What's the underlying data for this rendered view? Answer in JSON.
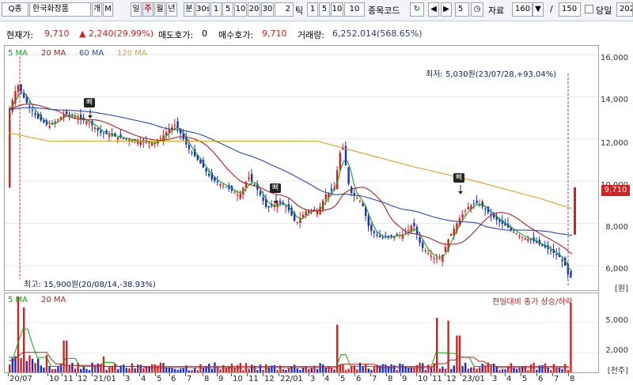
{
  "toolbar": {
    "search_label": "Q종",
    "stock_name": "한국화장품",
    "btn_ge": "개",
    "btn_m": "M",
    "periods": [
      "일",
      "주",
      "월",
      "년",
      "분"
    ],
    "active_period": "일",
    "min_select": "30s",
    "min_buttons": [
      "1",
      "5",
      "10",
      "20",
      "30"
    ],
    "tick_value": "2",
    "tick_label": "틱",
    "tick_buttons": [
      "1",
      "5",
      "10",
      "10"
    ],
    "code_label": "종목코드",
    "count_value": "5",
    "data_label": "자료",
    "data_value": "160",
    "slash": "/",
    "total_value": "150",
    "day_label": "당일",
    "date_value": "202"
  },
  "info": {
    "price_label": "현재가:",
    "price_value": "9,710",
    "change_value": "2,240(29.99%)",
    "ask_label": "매도호가:",
    "ask_value": "0",
    "bid_label": "매수호가:",
    "bid_value": "9,710",
    "volume_label": "거래량:",
    "volume_value": "6,252,014(568.65%)"
  },
  "legend_price": [
    "5 MA",
    "20 MA",
    "60 MA",
    "120 MA"
  ],
  "legend_volume": [
    "5 MA",
    "20 MA"
  ],
  "colors": {
    "ma5": "#12a312",
    "ma20": "#b42020",
    "ma60": "#2a47b8",
    "ma120": "#e0a020",
    "up": "#d62020",
    "down": "#1a2ec8"
  },
  "price_axis": [
    "16,000",
    "14,000",
    "12,000",
    "10,000",
    "8,000",
    "6,000"
  ],
  "price_unit": "[원]",
  "volume_axis": [
    "5,000",
    "2,000"
  ],
  "volume_unit": "[천주]",
  "current_price_tag": "9,710",
  "annotations": {
    "low": "최저: 5,030원(23/07/28,+93.04%)",
    "high": "최고: 15,900원(20/08/14,-38.93%)",
    "volume_note": "전일대비 종가 상승/하락",
    "flag": "삐"
  },
  "x_axis": [
    {
      "label": "20/07",
      "pos": 12
    },
    {
      "label": "10",
      "pos": 62
    },
    {
      "label": "11",
      "pos": 80
    },
    {
      "label": "12",
      "pos": 98
    },
    {
      "label": "21/01",
      "pos": 118
    },
    {
      "label": "3",
      "pos": 158
    },
    {
      "label": "4",
      "pos": 178
    },
    {
      "label": "5",
      "pos": 198
    },
    {
      "label": "6",
      "pos": 216
    },
    {
      "label": "7",
      "pos": 236
    },
    {
      "label": "8",
      "pos": 258
    },
    {
      "label": "9",
      "pos": 276
    },
    {
      "label": "10",
      "pos": 294
    },
    {
      "label": "11",
      "pos": 314
    },
    {
      "label": "12",
      "pos": 334
    },
    {
      "label": "22/01",
      "pos": 354
    },
    {
      "label": "3",
      "pos": 392
    },
    {
      "label": "4",
      "pos": 410
    },
    {
      "label": "5",
      "pos": 430
    },
    {
      "label": "6",
      "pos": 450
    },
    {
      "label": "7",
      "pos": 470
    },
    {
      "label": "8",
      "pos": 490
    },
    {
      "label": "9",
      "pos": 508
    },
    {
      "label": "10",
      "pos": 528
    },
    {
      "label": "11",
      "pos": 546
    },
    {
      "label": "12",
      "pos": 564
    },
    {
      "label": "23/01",
      "pos": 584
    },
    {
      "label": "3",
      "pos": 622
    },
    {
      "label": "4",
      "pos": 640
    },
    {
      "label": "5",
      "pos": 660
    },
    {
      "label": "6",
      "pos": 680
    },
    {
      "label": "7",
      "pos": 700
    },
    {
      "label": "8",
      "pos": 720
    }
  ]
}
